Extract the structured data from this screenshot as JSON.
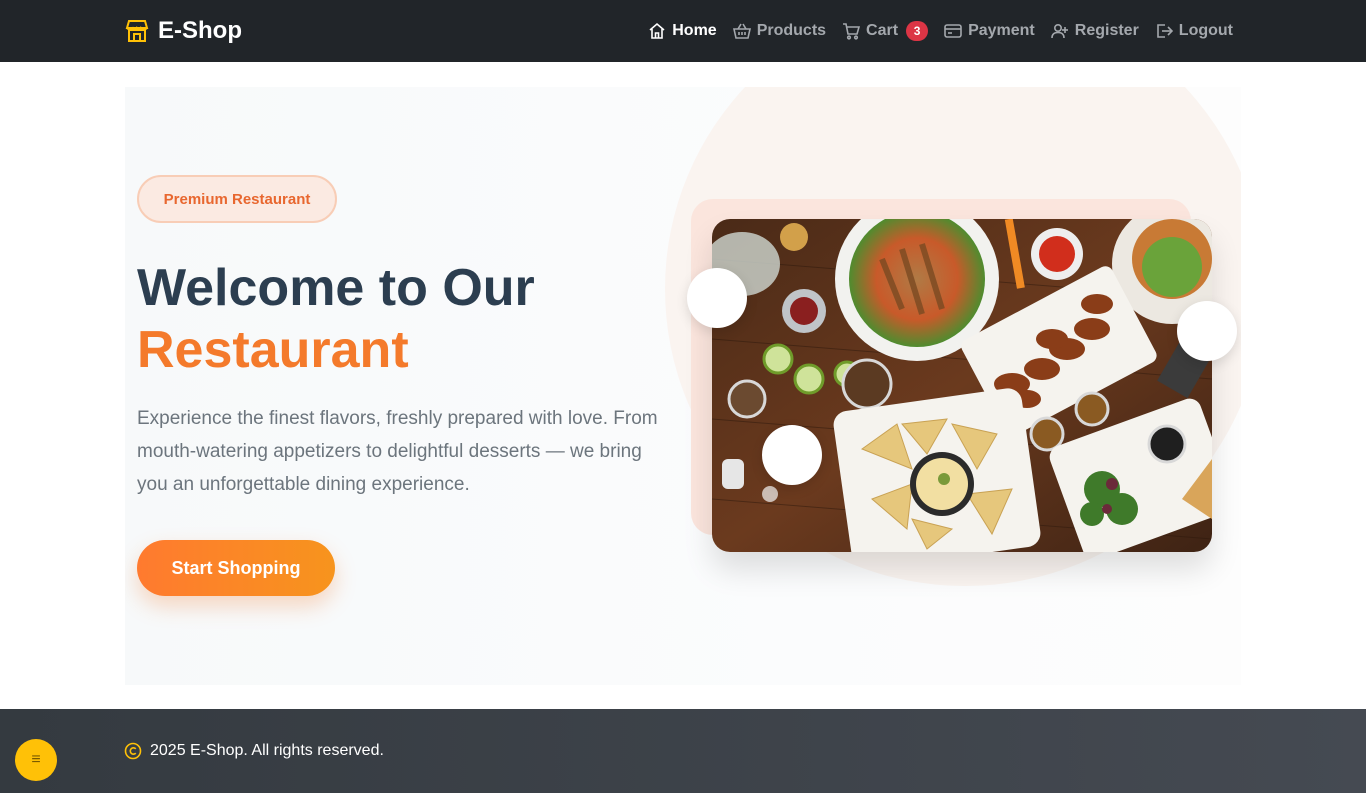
{
  "navbar": {
    "brand": "E-Shop",
    "links": [
      {
        "label": "Home",
        "icon": "home-icon",
        "active": true
      },
      {
        "label": "Products",
        "icon": "basket-icon"
      },
      {
        "label": "Cart",
        "icon": "cart-icon",
        "badge": "3"
      },
      {
        "label": "Payment",
        "icon": "credit-card-icon"
      },
      {
        "label": "Register",
        "icon": "user-plus-icon"
      },
      {
        "label": "Logout",
        "icon": "logout-icon"
      }
    ]
  },
  "hero": {
    "pill": "Premium Restaurant",
    "title_line1": "Welcome to Our",
    "title_line2": "Restaurant",
    "text": "Experience the finest flavors, freshly prepared with love. From mouth-watering appetizers to delightful desserts — we bring you an unforgettable dining experience.",
    "cta": "Start Shopping",
    "image_icon": "food-spread-image"
  },
  "footer": {
    "copyright": "2025 E-Shop. All rights reserved.",
    "copyright_icon": "copyright-icon",
    "fab_icon": "menu-toggle-icon",
    "fab_label": "≡"
  },
  "colors": {
    "navbar_bg": "#212529",
    "accent": "#f47a2b",
    "badge": "#dc3545",
    "footer_bg": "#343a40",
    "fab": "#ffc107",
    "brand_icon": "#ffc107"
  }
}
